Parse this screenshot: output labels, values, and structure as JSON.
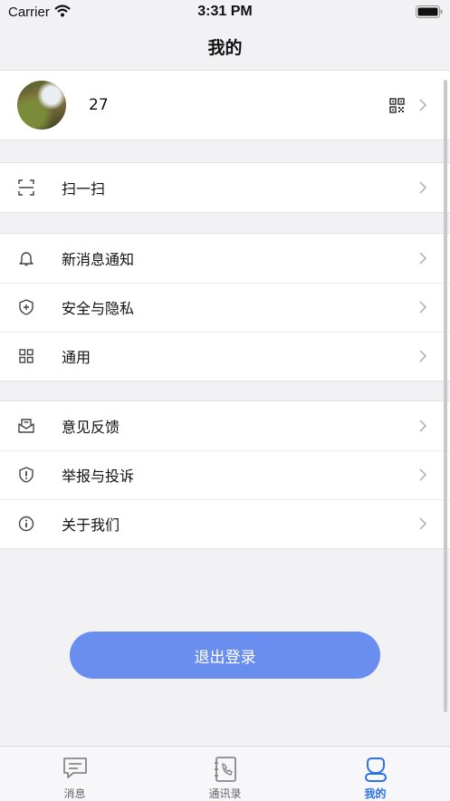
{
  "status_bar": {
    "carrier": "Carrier",
    "time": "3:31 PM"
  },
  "nav": {
    "title": "我的"
  },
  "profile": {
    "name": "27",
    "icons": [
      "avatar",
      "qr-code-icon",
      "chevron-right-icon"
    ]
  },
  "sections": [
    {
      "items": [
        {
          "label": "扫一扫",
          "icon": "scan-icon"
        }
      ]
    },
    {
      "items": [
        {
          "label": "新消息通知",
          "icon": "bell-icon"
        },
        {
          "label": "安全与隐私",
          "icon": "shield-plus-icon"
        },
        {
          "label": "通用",
          "icon": "grid-icon"
        }
      ]
    },
    {
      "items": [
        {
          "label": "意见反馈",
          "icon": "feedback-mail-icon"
        },
        {
          "label": "举报与投诉",
          "icon": "shield-alert-icon"
        },
        {
          "label": "关于我们",
          "icon": "info-icon"
        }
      ]
    }
  ],
  "logout": {
    "label": "退出登录"
  },
  "tabs": [
    {
      "label": "消息",
      "icon": "chat-icon",
      "active": false
    },
    {
      "label": "通讯录",
      "icon": "contacts-icon",
      "active": false
    },
    {
      "label": "我的",
      "icon": "profile-icon",
      "active": true
    }
  ],
  "colors": {
    "accent": "#2a72e6",
    "logout_button": "#6a8ef0",
    "background": "#f2f2f4"
  }
}
